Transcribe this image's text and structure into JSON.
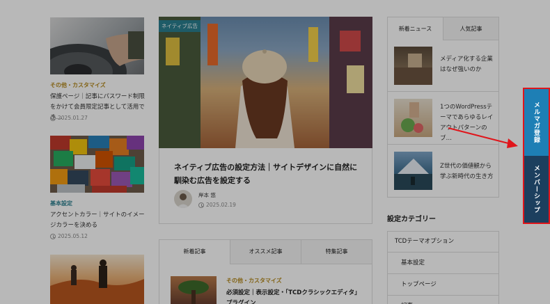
{
  "left_posts": [
    {
      "category": "その他・カスタマイズ",
      "title": "保護ページ｜記事にパスワード制限をかけて会員限定記事として活用でき…",
      "date": "2025.01.27",
      "category_color": "#b58a1e"
    },
    {
      "category": "基本設定",
      "title": "アクセントカラー｜サイトのイメージカラーを決める",
      "date": "2025.05.12",
      "category_color": "#2a7f8f"
    }
  ],
  "featured": {
    "label": "ネイティブ広告",
    "title": "ネイティブ広告の設定方法｜サイトデザインに自然に馴染む広告を設定する",
    "author": "岸本 悠",
    "date": "2025.02.19"
  },
  "bottom_tabs": [
    "新着記事",
    "オススメ記事",
    "特集記事"
  ],
  "bottom_post": {
    "category": "その他・カスタマイズ",
    "title": "必須設定｜表示設定・「TCDクラシックエディタ」プラグイン"
  },
  "news_tabs": [
    "新着ニュース",
    "人気記事"
  ],
  "news": [
    {
      "title": "メディア化する企業はなぜ強いのか"
    },
    {
      "title": "1つのWordPressテーマであらゆるレイアウトパターンのブ…"
    },
    {
      "title": "Z世代の価値観から学ぶ新時代の生き方"
    }
  ],
  "category_heading": "設定カテゴリー",
  "categories": [
    "TCDテーマオプション",
    "基本設定",
    "トップページ",
    "記事"
  ],
  "side_buttons": {
    "newsletter": "メルマガ登録",
    "membership": "メンバーシップ"
  },
  "colors": {
    "accent_teal": "#2a7f8f",
    "newsletter_blue": "#1e7fb5",
    "member_navy": "#1c3f5e",
    "highlight_red": "#e0151b"
  }
}
